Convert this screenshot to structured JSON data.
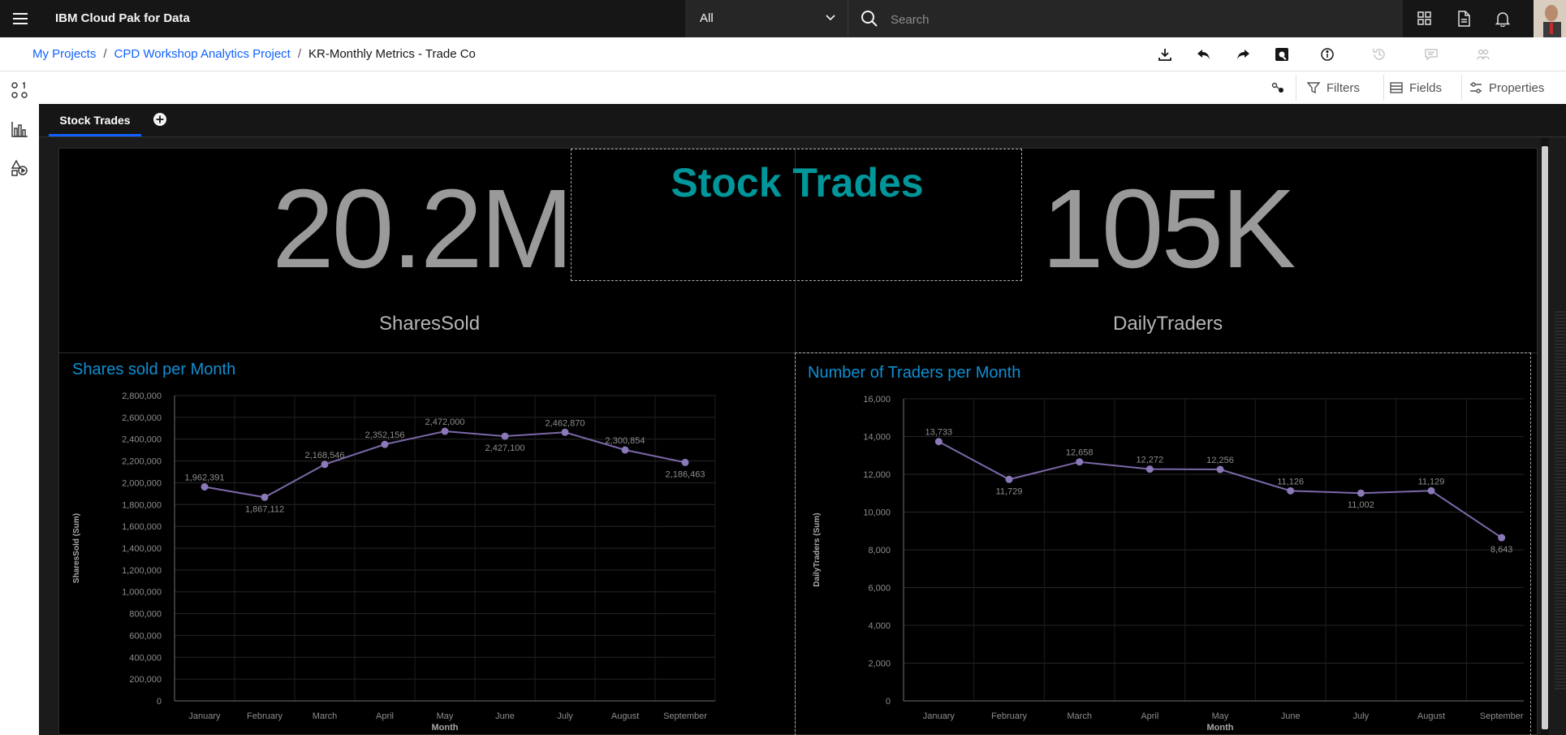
{
  "header": {
    "app_title": "IBM Cloud Pak for Data",
    "scope": "All",
    "search_placeholder": "Search"
  },
  "breadcrumb": {
    "items": [
      "My Projects",
      "CPD Workshop Analytics Project"
    ],
    "current": "KR-Monthly Metrics - Trade Co"
  },
  "toolbar": {
    "filters": "Filters",
    "fields": "Fields",
    "properties": "Properties"
  },
  "tabs": [
    {
      "label": "Stock Trades",
      "active": true
    }
  ],
  "dashboard": {
    "title": "Stock Trades",
    "kpis": [
      {
        "value": "20.2M",
        "label": "SharesSold"
      },
      {
        "value": "105K",
        "label": "DailyTraders"
      }
    ]
  },
  "colors": {
    "accent": "#0f62fe",
    "title_teal": "#00969a",
    "chart_title": "#0f8fd3",
    "line": "#7b68a8"
  },
  "chart_data": [
    {
      "type": "line",
      "title": "Shares sold per Month",
      "xlabel": "Month",
      "ylabel": "SharesSold (Sum)",
      "categories": [
        "January",
        "February",
        "March",
        "April",
        "May",
        "June",
        "July",
        "August",
        "September"
      ],
      "values": [
        1962391,
        1867112,
        2168546,
        2352156,
        2472000,
        2427100,
        2462870,
        2300854,
        2186463
      ],
      "labels": [
        "1,962,391",
        "1,867,112",
        "2,168,546",
        "2,352,156",
        "2,472,000",
        "2,427,100",
        "2,462,870",
        "2,300,854",
        "2,186,463"
      ],
      "ylim": [
        0,
        2800000
      ],
      "yticks": [
        "0",
        "200,000",
        "400,000",
        "600,000",
        "800,000",
        "1,000,000",
        "1,200,000",
        "1,400,000",
        "1,600,000",
        "1,800,000",
        "2,000,000",
        "2,200,000",
        "2,400,000",
        "2,600,000",
        "2,800,000"
      ],
      "grid": true
    },
    {
      "type": "line",
      "title": "Number of Traders per Month",
      "xlabel": "Month",
      "ylabel": "DailyTraders (Sum)",
      "categories": [
        "January",
        "February",
        "March",
        "April",
        "May",
        "June",
        "July",
        "August",
        "September"
      ],
      "values": [
        13733,
        11729,
        12658,
        12272,
        12256,
        11126,
        11002,
        11129,
        8643
      ],
      "labels": [
        "13,733",
        "11,729",
        "12,658",
        "12,272",
        "12,256",
        "11,126",
        "11,002",
        "11,129",
        "8,643"
      ],
      "ylim": [
        0,
        16000
      ],
      "yticks": [
        "0",
        "2,000",
        "4,000",
        "6,000",
        "8,000",
        "10,000",
        "12,000",
        "14,000",
        "16,000"
      ],
      "grid": true
    }
  ]
}
